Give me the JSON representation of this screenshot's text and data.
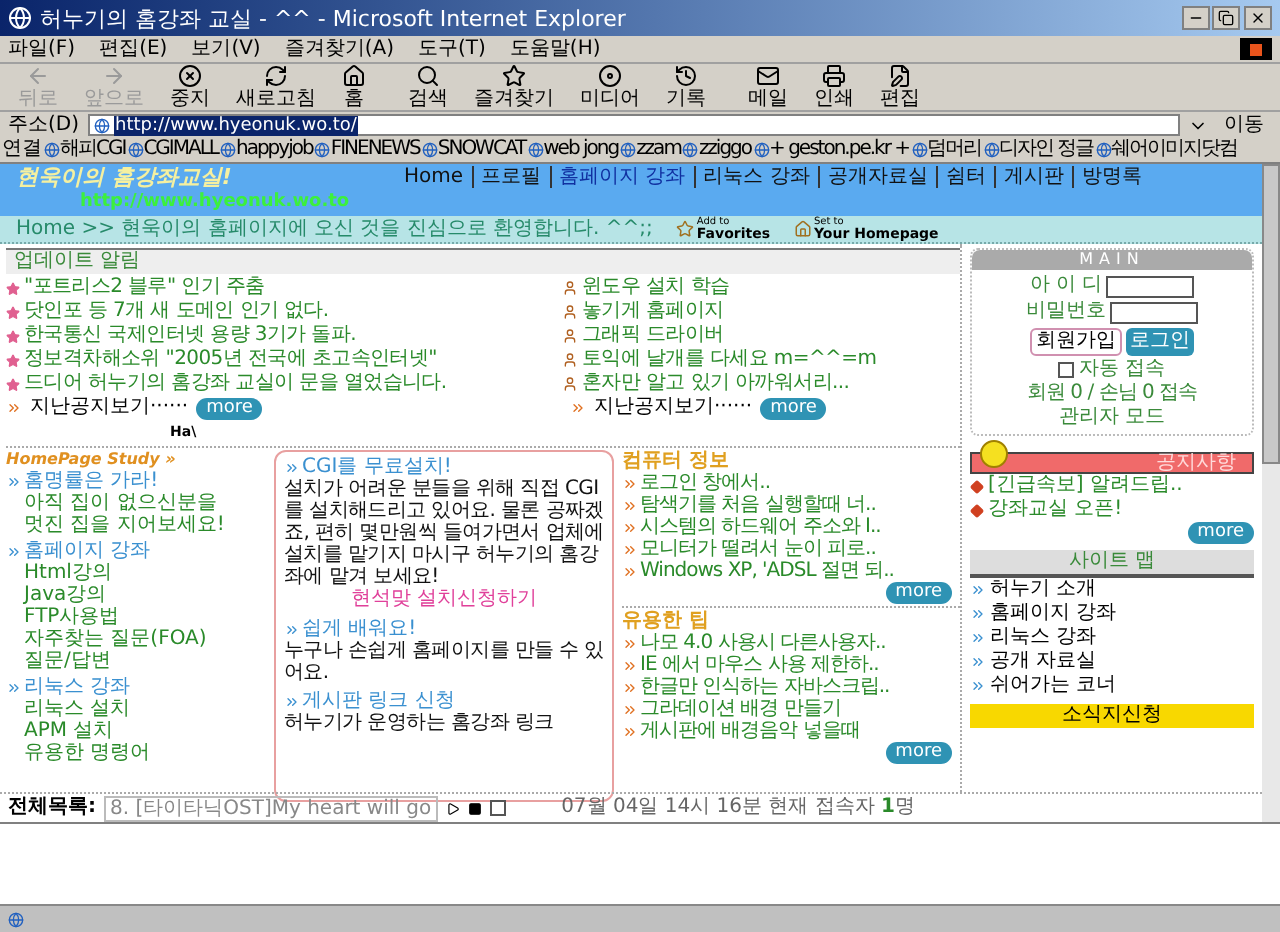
{
  "window": {
    "title": "허누기의 홈강좌 교실 - ^^ - Microsoft Internet Explorer"
  },
  "menu": [
    "파일(F)",
    "편집(E)",
    "보기(V)",
    "즐겨찾기(A)",
    "도구(T)",
    "도움말(H)"
  ],
  "toolbar": [
    {
      "kind": "back",
      "label": "뒤로",
      "disabled": true
    },
    {
      "kind": "forward",
      "label": "앞으로",
      "disabled": true
    },
    {
      "kind": "stop",
      "label": "중지",
      "disabled": false
    },
    {
      "kind": "refresh",
      "label": "새로고침",
      "disabled": false
    },
    {
      "kind": "home",
      "label": "홈",
      "disabled": false
    },
    {
      "kind": "search",
      "label": "검색",
      "disabled": false
    },
    {
      "kind": "favorites",
      "label": "즐겨찾기",
      "disabled": false
    },
    {
      "kind": "media",
      "label": "미디어",
      "disabled": false
    },
    {
      "kind": "history",
      "label": "기록",
      "disabled": false
    },
    {
      "kind": "mail",
      "label": "메일",
      "disabled": false
    },
    {
      "kind": "print",
      "label": "인쇄",
      "disabled": false
    },
    {
      "kind": "edit",
      "label": "편집",
      "disabled": false
    }
  ],
  "address": {
    "label": "주소(D)",
    "value": "http://www.hyeonuk.wo.to/",
    "go": "이동"
  },
  "links": {
    "label": "연결",
    "items": [
      "해피CGI",
      "CGIMALL",
      "happyjob",
      "FINENEWS",
      "SNOWCAT",
      "web jong",
      "zzam",
      "zziggo",
      "+ geston.pe.kr +",
      "덤머리",
      "디자인 정글",
      "쉐어이미지닷컴"
    ]
  },
  "page": {
    "header": {
      "logo": "현욱이의 홈강좌교실!",
      "url": "http://www.hyeonuk.wo.to",
      "nav": [
        "Home",
        "프로필",
        "홈페이지 강좌",
        "리눅스 강좌",
        "공개자료실",
        "쉼터",
        "게시판",
        "방명록"
      ]
    },
    "welcome": {
      "text": "Home >> 현욱이의 홈페이지에 오신 것을 진심으로 환영합니다. ^^;;",
      "favorites_small": "Add to",
      "favorites": "Favorites",
      "homepage_small": "Set to",
      "homepage": "Your Homepage"
    },
    "updates": {
      "title": "업데이트 알림",
      "left": [
        "\"포트리스2 블루\" 인기 주춤",
        "닷인포 등 7개 새 도메인 인기 없다.",
        "한국통신 국제인터넷 용량 3기가 돌파.",
        "정보격차해소위 \"2005년 전국에 초고속인터넷\"",
        "드디어 허누기의 홈강좌 교실이 문을 열었습니다."
      ],
      "right": [
        "윈도우 설치 학습",
        "놓기게 홈페이지",
        "그래픽 드라이버",
        "토익에 날개를 다세요 m=^^=m",
        "혼자만 알고 있기 아까워서리..."
      ],
      "past_left": "지난공지보기······",
      "more_left": "more",
      "past_right": "지난공지보기······",
      "more_right": "more"
    },
    "note": "Ha\\",
    "study": {
      "title": "HomePage Study »",
      "sections": [
        {
          "heading": "홈명률은 가라!",
          "lines": [
            "아직 집이 없으신분을",
            "멋진 집을 지어보세요!"
          ]
        },
        {
          "heading": "홈페이지 강좌",
          "lines": [
            "Html강의",
            "Java강의",
            "FTP사용법",
            "자주찾는 질문(FOA)",
            "질문/답변"
          ]
        },
        {
          "heading": "리눅스 강좌",
          "lines": [
            "리눅스 설치",
            "APM 설치",
            "유용한 명령어"
          ]
        }
      ]
    },
    "cgi": {
      "sections": [
        {
          "heading": "CGI를 무료설치!",
          "text": "설치가 어려운 분들을 위해 직접 CGI를 설치해드리고 있어요. 물론 공짜겠죠, 편히 몇만원씩 들여가면서 업체에 설치를 맡기지 마시구 허누기의 홈강좌에 맡겨 보세요!",
          "link": "현석맞 설치신청하기"
        },
        {
          "heading": "쉽게 배워요!",
          "text": "누구나 손쉽게 홈페이지를 만들 수 있어요."
        },
        {
          "heading": "게시판 링크 신청",
          "text": "허누기가 운영하는 홈강좌 링크"
        }
      ]
    },
    "computer": {
      "title": "컴퓨터 정보",
      "items": [
        "로그인 창에서..",
        "탐색기를 처음 실행할때 너..",
        "시스템의 하드웨어 주소와 I..",
        "모니터가 떨려서 눈이 피로..",
        "Windows XP, 'ADSL 절면 되.."
      ],
      "more": "more"
    },
    "tips": {
      "title": "유용한 팁",
      "items": [
        "나모 4.0 사용시 다른사용자..",
        "IE 에서 마우스 사용 제한하..",
        "한글만 인식하는 자바스크립..",
        "그라데이션 배경 만들기",
        "게시판에 배경음악 넣을때"
      ],
      "more": "more"
    },
    "login": {
      "title": "MAIN",
      "id_label": "아 이 디",
      "pw_label": "비밀번호",
      "join": "회원가입",
      "login": "로그인",
      "auto": "자동 접속",
      "auto_checked": false,
      "stats": "회원 0 / 손님 0 접속",
      "admin": "관리자 모드"
    },
    "notice": {
      "title": "공지사항",
      "items": [
        "[긴급속보] 알려드립..",
        "강좌교실 오픈!"
      ],
      "more": "more"
    },
    "sitemap": {
      "title": "사이트 맵",
      "items": [
        "허누기 소개",
        "홈페이지 강좌",
        "리눅스 강좌",
        "공개 자료실",
        "쉬어가는 코너"
      ]
    },
    "subscribe": "소식지신청",
    "player": {
      "label": "전체목록:",
      "value": "8. [타이타닉OST]My heart will go",
      "repeat_checked": false,
      "status": "07월 04일 14시 16분 현재 접속자 ",
      "count": "1",
      "unit": "명"
    }
  }
}
